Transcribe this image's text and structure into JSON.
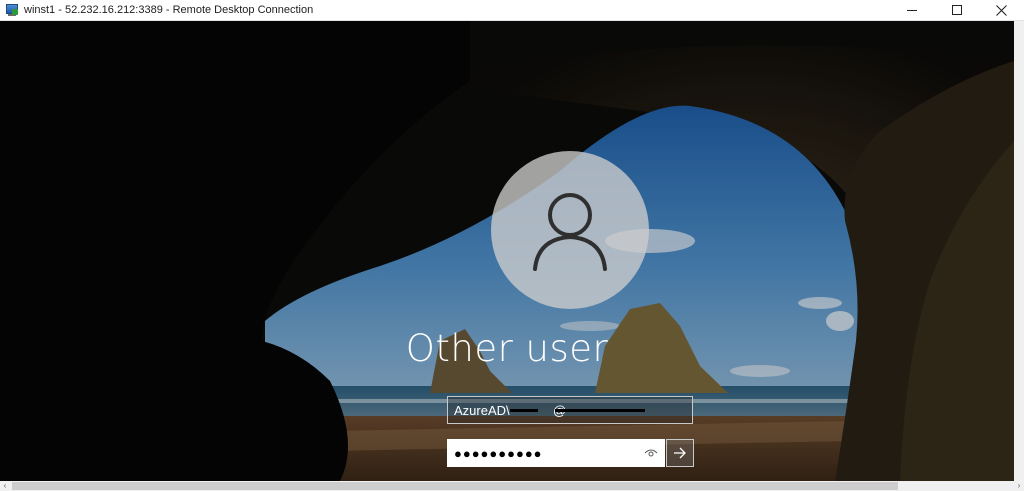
{
  "window": {
    "title": "winst1 - 52.232.16.212:3389 - Remote Desktop Connection",
    "minimize_icon": "minimize-icon",
    "maximize_icon": "maximize-icon",
    "close_icon": "close-icon"
  },
  "login": {
    "account_name": "Other user",
    "avatar_icon": "user-silhouette-icon",
    "username_value": "AzureAD\\            @",
    "password_value": "●●●●●●●●●●",
    "reveal_icon": "eye-icon",
    "submit_icon": "arrow-right-icon"
  },
  "scrollbar": {
    "left_arrow": "‹",
    "right_arrow": "›"
  },
  "colors": {
    "sky": "#3f7fbe",
    "cave": "#0b0b0a",
    "field_border": "#c9c9c9"
  }
}
